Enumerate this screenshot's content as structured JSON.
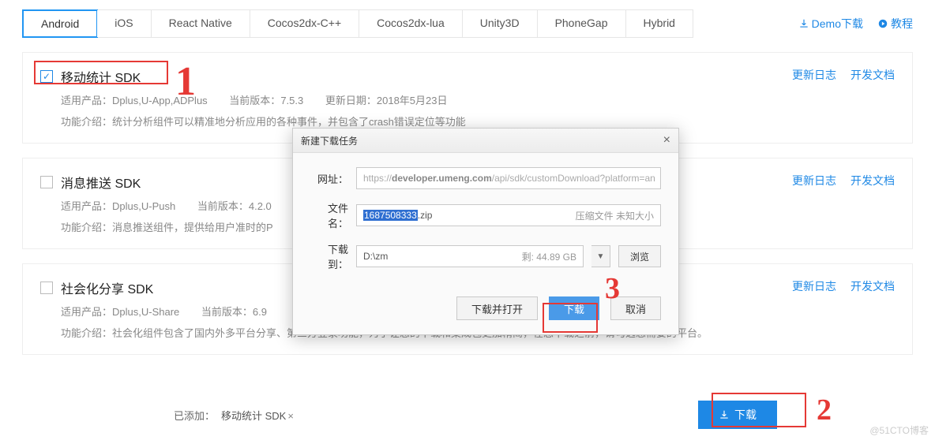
{
  "tabs": [
    "Android",
    "iOS",
    "React Native",
    "Cocos2dx-C++",
    "Cocos2dx-lua",
    "Unity3D",
    "PhoneGap",
    "Hybrid"
  ],
  "top_links": {
    "demo": "Demo下载",
    "tutorial": "教程"
  },
  "sdk_links": {
    "changelog": "更新日志",
    "docs": "开发文档"
  },
  "sdks": [
    {
      "title": "移动统计 SDK",
      "checked": true,
      "products_label": "适用产品：",
      "products": "Dplus,U-App,ADPlus",
      "version_label": "当前版本：",
      "version": "7.5.3",
      "date_label": "更新日期：",
      "date": "2018年5月23日",
      "intro_label": "功能介绍：",
      "intro": "统计分析组件可以精准地分析应用的各种事件，并包含了crash错误定位等功能"
    },
    {
      "title": "消息推送 SDK",
      "checked": false,
      "products_label": "适用产品：",
      "products": "Dplus,U-Push",
      "version_label": "当前版本：",
      "version": "4.2.0",
      "intro_label": "功能介绍：",
      "intro": "消息推送组件，提供给用户准时的P"
    },
    {
      "title": "社会化分享 SDK",
      "checked": false,
      "products_label": "适用产品：",
      "products": "Dplus,U-Share",
      "version_label": "当前版本：",
      "version": "6.9",
      "intro_label": "功能介绍：",
      "intro": "社会化组件包含了国内外多平台分享、第三方登录功能，为了让您的下载和集成包更加精简，在您下载之前，请勾选您需要的平台。"
    }
  ],
  "footer": {
    "added_label": "已添加：",
    "chip": "移动统计 SDK",
    "download": "下载"
  },
  "dialog": {
    "title": "新建下载任务",
    "url_label": "网址：",
    "url_prefix": "https://",
    "url_bold": "developer.umeng.com",
    "url_rest": "/api/sdk/customDownload?platform=an",
    "file_label": "文件名：",
    "file_sel": "1687508333",
    "file_ext": ".zip",
    "file_hint": "压缩文件 未知大小",
    "path_label": "下载到：",
    "path": "D:\\zm",
    "path_free": "剩: 44.89 GB",
    "browse": "浏览",
    "open_btn": "下载并打开",
    "dl_btn": "下载",
    "cancel_btn": "取消"
  },
  "annotations": {
    "one": "1",
    "two": "2",
    "three": "3"
  },
  "watermark": "@51CTO博客"
}
